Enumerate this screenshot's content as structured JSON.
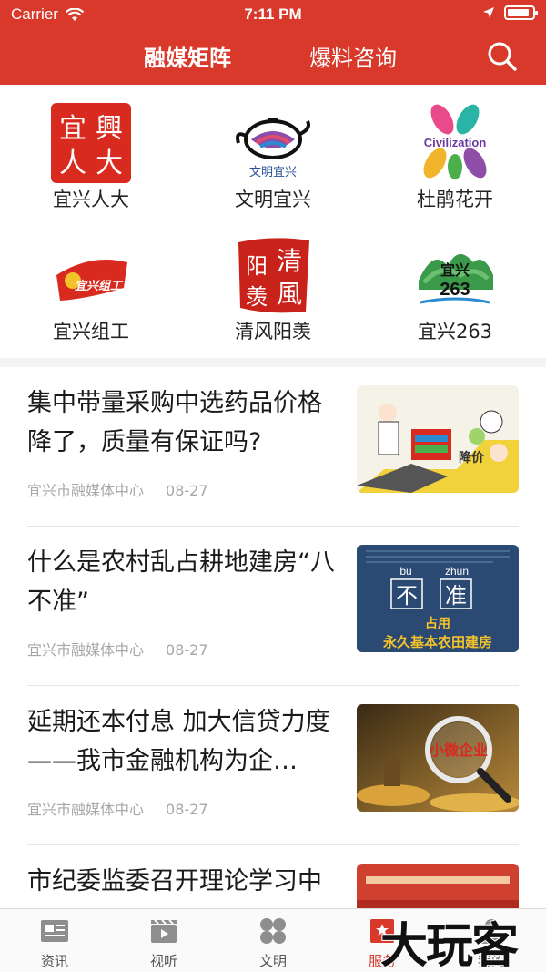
{
  "status_bar": {
    "carrier": "Carrier",
    "time": "7:11 PM",
    "battery_level": 0.9
  },
  "header": {
    "tabs": [
      {
        "label": "融媒矩阵",
        "active": true
      },
      {
        "label": "爆料咨询",
        "active": false
      }
    ],
    "search_icon": "search-icon",
    "color": "#d8392b"
  },
  "grid": {
    "items": [
      {
        "label": "宜兴人大",
        "logo_text": "宜興人大"
      },
      {
        "label": "文明宜兴",
        "logo_text": "文明宜兴"
      },
      {
        "label": "杜鹃花开",
        "logo_text": "Civilization"
      },
      {
        "label": "宜兴组工",
        "logo_text": "宜兴组工"
      },
      {
        "label": "清风阳羡",
        "logo_text": "清風阳羡"
      },
      {
        "label": "宜兴263",
        "logo_text": "宜兴263"
      }
    ]
  },
  "news": [
    {
      "title": "集中带量采购中选药品价格降了，质量有保证吗?",
      "source": "宜兴市融媒体中心",
      "date": "08-27",
      "thumb_text": "降价"
    },
    {
      "title": "什么是农村乱占耕地建房“八不准”",
      "source": "宜兴市融媒体中心",
      "date": "08-27",
      "thumb": {
        "pinyin_1": "bu",
        "pinyin_2": "zhun",
        "char_1": "不",
        "char_2": "准",
        "line_1": "占用",
        "line_2": "永久基本农田建房"
      }
    },
    {
      "title": "延期还本付息 加大信贷力度——我市金融机构为企…",
      "source": "宜兴市融媒体中心",
      "date": "08-27",
      "thumb_text": "小微企业"
    },
    {
      "title": "市纪委监委召开理论学习中",
      "source": "",
      "date": ""
    }
  ],
  "tabbar": {
    "items": [
      {
        "label": "资讯",
        "icon": "news-icon",
        "active": false
      },
      {
        "label": "视听",
        "icon": "video-icon",
        "active": false
      },
      {
        "label": "文明",
        "icon": "civilization-icon",
        "active": false
      },
      {
        "label": "服务",
        "icon": "service-icon",
        "active": true
      },
      {
        "label": "我的",
        "icon": "profile-icon",
        "active": false
      }
    ],
    "active_color": "#d8392b"
  },
  "watermark": "大玩客"
}
